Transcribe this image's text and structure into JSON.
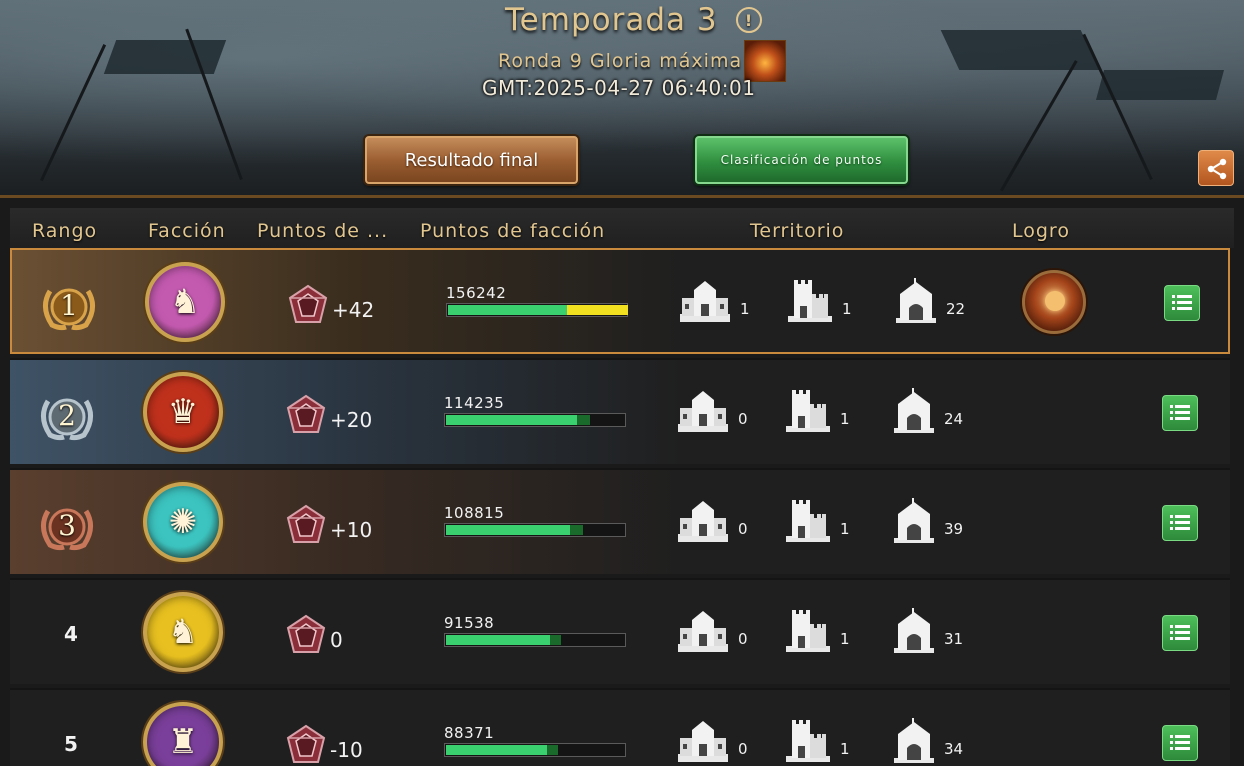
{
  "header": {
    "title": "Temporada 3",
    "round": "Ronda 9 Gloria máxima",
    "gmt": "GMT:2025-04-27 06:40:01",
    "btn_final": "Resultado final",
    "btn_points": "Clasificación de puntos"
  },
  "columns": {
    "rank": "Rango",
    "faction": "Facción",
    "points": "Puntos de ...",
    "faction_points": "Puntos de facción",
    "territory": "Territorio",
    "achievement": "Logro"
  },
  "rows": [
    {
      "rank": "1",
      "points": "+42",
      "faction_points": "156242",
      "bar_green_pct": 0.66,
      "bar_yellow_pct": 0.34,
      "bar_dark_pct": 1.0,
      "t1": "1",
      "t2": "1",
      "t3": "22",
      "faction_color": "#c45ab0",
      "sigil": "stag"
    },
    {
      "rank": "2",
      "points": "+20",
      "faction_points": "114235",
      "bar_green_pct": 0.73,
      "bar_yellow_pct": 0,
      "bar_dark_pct": 0.8,
      "t1": "0",
      "t2": "1",
      "t3": "24",
      "faction_color": "#c0311c",
      "sigil": "lion"
    },
    {
      "rank": "3",
      "points": "+10",
      "faction_points": "108815",
      "bar_green_pct": 0.69,
      "bar_yellow_pct": 0,
      "bar_dark_pct": 0.76,
      "t1": "0",
      "t2": "1",
      "t3": "39",
      "faction_color": "#3cc4c0",
      "sigil": "kraken"
    },
    {
      "rank": "4",
      "points": "0",
      "faction_points": "91538",
      "bar_green_pct": 0.58,
      "bar_yellow_pct": 0,
      "bar_dark_pct": 0.64,
      "t1": "0",
      "t2": "1",
      "t3": "31",
      "faction_color": "#e8c020",
      "sigil": "wolf"
    },
    {
      "rank": "5",
      "points": "-10",
      "faction_points": "88371",
      "bar_green_pct": 0.56,
      "bar_yellow_pct": 0,
      "bar_dark_pct": 0.62,
      "t1": "0",
      "t2": "1",
      "t3": "34",
      "faction_color": "#7a3f9a",
      "sigil": "dragon"
    }
  ]
}
